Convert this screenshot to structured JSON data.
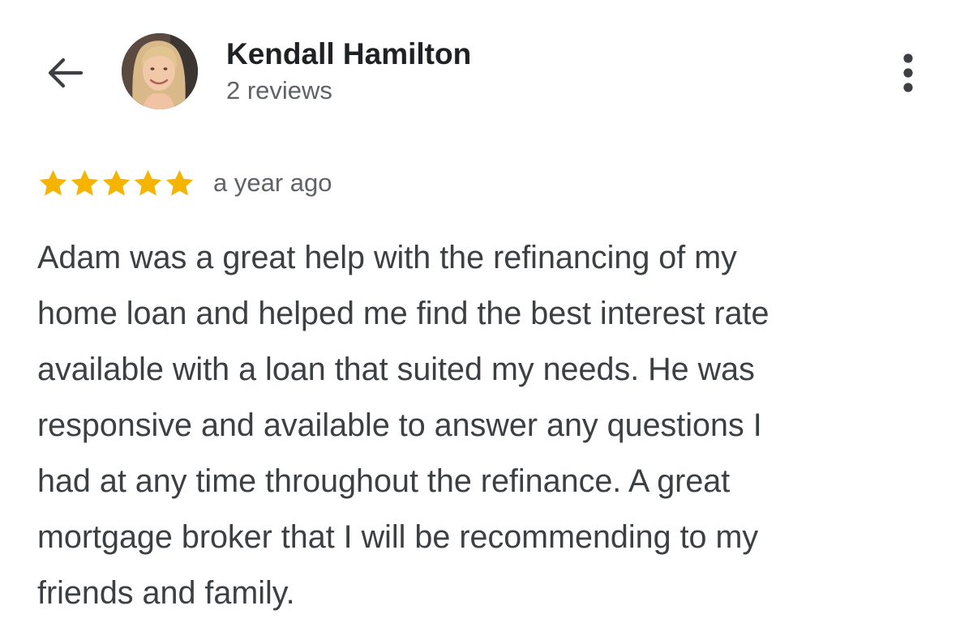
{
  "header": {
    "back_icon": "arrow-left-icon",
    "reviewer_name": "Kendall Hamilton",
    "review_count": "2 reviews",
    "more_icon": "more-vertical-icon"
  },
  "review": {
    "rating": 5,
    "max_rating": 5,
    "star_color": "#f4b400",
    "time_ago": "a year ago",
    "text_lines": [
      "Adam was a great help with the refinancing of my",
      "home loan and helped me find the best interest rate",
      "available with a loan that suited my needs. He was",
      "responsive and available to answer any questions I",
      "had at any time throughout the refinance. A great",
      "mortgage broker that I will be recommending to my",
      "friends and family."
    ]
  }
}
